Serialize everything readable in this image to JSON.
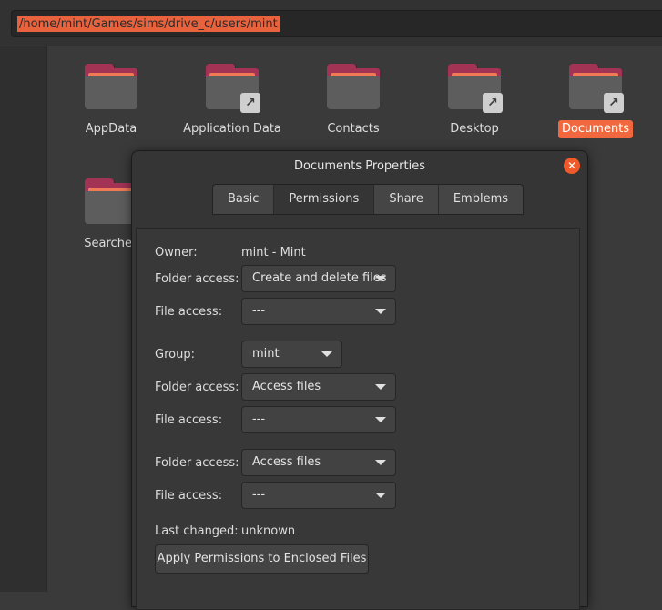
{
  "location": {
    "path": "/home/mint/Games/sims/drive_c/users/mint"
  },
  "folders": [
    {
      "label": "AppData",
      "link": false
    },
    {
      "label": "Application Data",
      "link": true
    },
    {
      "label": "Contacts",
      "link": false
    },
    {
      "label": "Desktop",
      "link": true
    },
    {
      "label": "Documents",
      "link": true,
      "selected": true
    },
    {
      "label": "Searches",
      "link": false
    }
  ],
  "dialog": {
    "title": "Documents Properties",
    "tabs": [
      "Basic",
      "Permissions",
      "Share",
      "Emblems"
    ],
    "active_tab": "Permissions",
    "owner": {
      "label": "Owner:",
      "value": "mint - Mint"
    },
    "owner_folder_access": {
      "label": "Folder access:",
      "value": "Create and delete files"
    },
    "owner_file_access": {
      "label": "File access:",
      "value": "---"
    },
    "group": {
      "label": "Group:",
      "value": "mint"
    },
    "group_folder_access": {
      "label": "Folder access:",
      "value": "Access files"
    },
    "group_file_access": {
      "label": "File access:",
      "value": "---"
    },
    "others_folder_access": {
      "label": "Folder access:",
      "value": "Access files"
    },
    "others_file_access": {
      "label": "File access:",
      "value": "---"
    },
    "last_changed": {
      "label": "Last changed:",
      "value": "unknown"
    },
    "apply_button": "Apply Permissions to Enclosed Files"
  },
  "colors": {
    "accent": "#f2683e",
    "close": "#f05a2a",
    "folder_back": "#a23355"
  }
}
